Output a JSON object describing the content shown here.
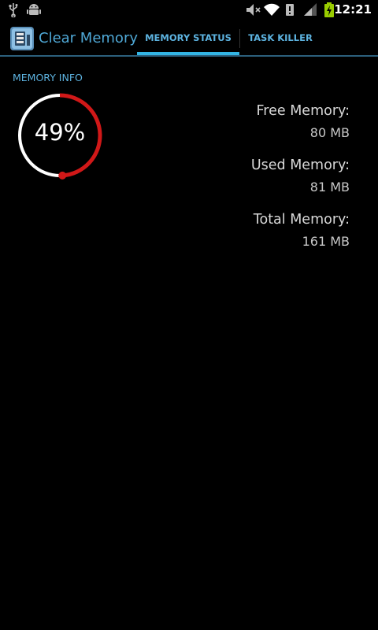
{
  "status_bar": {
    "time": "12:21",
    "icons": [
      "usb-icon",
      "android-debug-icon",
      "mute-icon",
      "wifi-icon",
      "data-icon",
      "signal-icon",
      "battery-charging-icon"
    ]
  },
  "action_bar": {
    "title": "Clear Memory",
    "tabs": [
      {
        "label": "MEMORY STATUS",
        "selected": true
      },
      {
        "label": "TASK KILLER",
        "selected": false
      }
    ]
  },
  "memory_info": {
    "header": "MEMORY INFO",
    "used_percent": 49,
    "percent_label": "49%",
    "free_label": "Free Memory:",
    "free_value": "80 MB",
    "used_label": "Used Memory:",
    "used_value": "81 MB",
    "total_label": "Total Memory:",
    "total_value": "161 MB"
  },
  "colors": {
    "accent": "#33b5e5",
    "gauge_used": "#d01818",
    "gauge_free": "#ffffff",
    "background": "#000000"
  }
}
